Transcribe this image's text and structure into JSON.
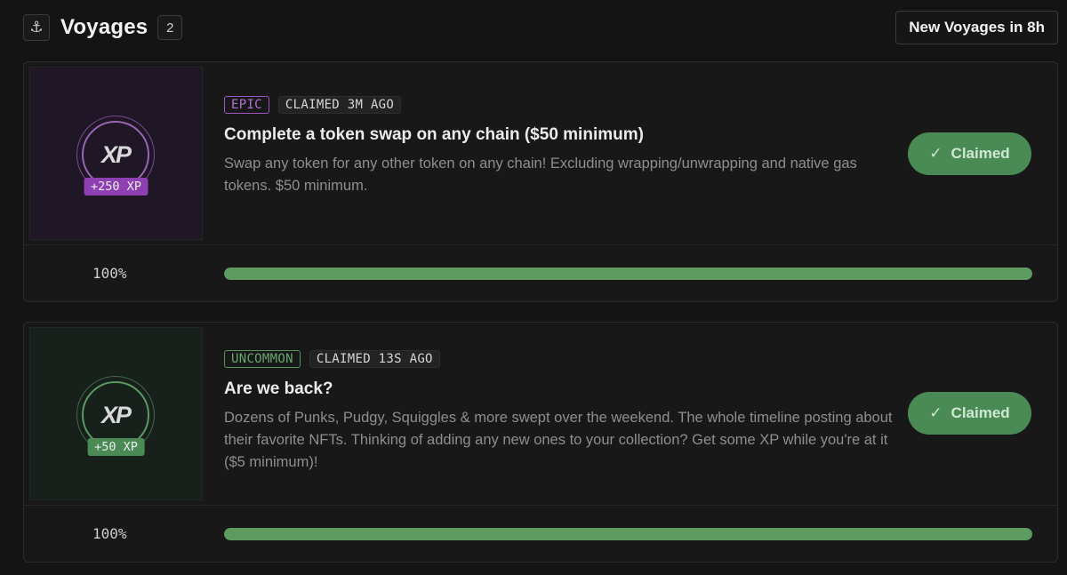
{
  "header": {
    "icon": "anchor-icon",
    "title": "Voyages",
    "count": "2",
    "new_voyages_label": "New Voyages in 8h"
  },
  "colors": {
    "epic": "#a055c2",
    "uncommon": "#56935f",
    "claimed_button": "#4a8a55",
    "progress": "#5e9b61"
  },
  "voyages": [
    {
      "rarity": "EPIC",
      "claimed_status": "CLAIMED 3M AGO",
      "xp_logo": "XP",
      "xp_reward": "+250 XP",
      "title": "Complete a token swap on any chain ($50 minimum)",
      "description": "Swap any token for any other token on any chain! Excluding wrapping/unwrapping and native gas tokens. $50 minimum.",
      "button_label": "Claimed",
      "button_icon": "check-icon",
      "progress_label": "100%",
      "progress": 1.0
    },
    {
      "rarity": "UNCOMMON",
      "claimed_status": "CLAIMED 13S AGO",
      "xp_logo": "XP",
      "xp_reward": "+50 XP",
      "title": "Are we back?",
      "description": "Dozens of Punks, Pudgy, Squiggles & more swept over the weekend. The whole timeline posting about their favorite NFTs. Thinking of adding any new ones to your collection? Get some XP while you're at it ($5 minimum)!",
      "button_label": "Claimed",
      "button_icon": "check-icon",
      "progress_label": "100%",
      "progress": 1.0
    }
  ]
}
